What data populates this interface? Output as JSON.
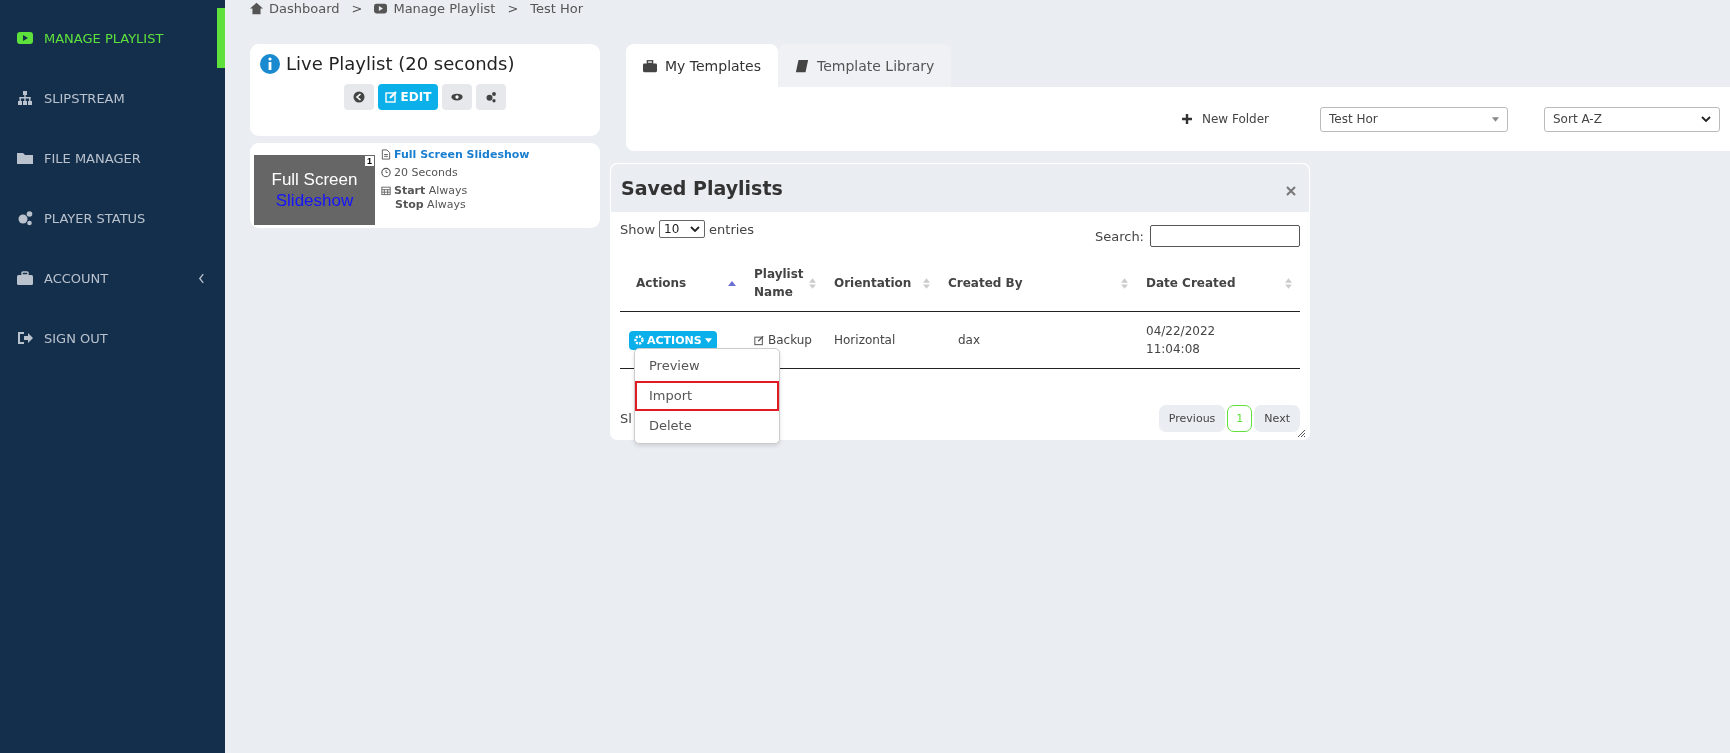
{
  "sidebar": {
    "items": [
      {
        "label": "MANAGE PLAYLIST",
        "selected": true,
        "has_submenu": false
      },
      {
        "label": "SLIPSTREAM",
        "selected": false,
        "has_submenu": false
      },
      {
        "label": "FILE MANAGER",
        "selected": false,
        "has_submenu": false
      },
      {
        "label": "PLAYER STATUS",
        "selected": false,
        "has_submenu": false
      },
      {
        "label": "ACCOUNT",
        "selected": false,
        "has_submenu": true
      },
      {
        "label": "SIGN OUT",
        "selected": false,
        "has_submenu": false
      }
    ]
  },
  "breadcrumb": [
    {
      "label": "Dashboard",
      "separator": ">"
    },
    {
      "label": "Manage Playlist",
      "separator": ">"
    },
    {
      "label": "Test Hor"
    }
  ],
  "live_playlist": {
    "title": "Live Playlist (20 seconds)",
    "edit_label": "EDIT",
    "items": [
      {
        "thumb_line_1": "Full Screen",
        "thumb_line_2": "Slideshow",
        "badge": "1",
        "name": "Full Screen Slideshow",
        "duration": "20 Seconds",
        "start_label": "Start",
        "start_value": "Always",
        "stop_label": "Stop",
        "stop_value": "Always"
      }
    ]
  },
  "tabs": [
    {
      "label": "My Templates",
      "selected": true
    },
    {
      "label": "Template Library",
      "selected": false
    }
  ],
  "toolbar": {
    "new_folder": "New Folder",
    "folder_select": "Test Hor",
    "sort_select": "Sort A-Z"
  },
  "dialog": {
    "title": "Saved Playlists",
    "show_label": "Show",
    "page_size": "10",
    "entries_label": "entries",
    "search_label": "Search:",
    "info_text": "Sl",
    "columns": [
      {
        "label": "Actions",
        "sorted": true
      },
      {
        "label": "Playlist Name",
        "sorted": false
      },
      {
        "label": "Orientation",
        "sorted": false
      },
      {
        "label": "Created By",
        "sorted": false
      },
      {
        "label": "Date Created",
        "sorted": false
      }
    ],
    "rows": [
      {
        "actions": "ACTIONS",
        "name": "Backup",
        "orientation": "Horizontal",
        "created_by": "dax",
        "date": "04/22/2022",
        "time": "11:04:08"
      }
    ],
    "menu": [
      {
        "label": "Preview",
        "highlighted": false
      },
      {
        "label": "Import",
        "highlighted": true
      },
      {
        "label": "Delete",
        "highlighted": false
      }
    ],
    "pagination": [
      {
        "label": "Previous",
        "kind": "nav",
        "selected": false
      },
      {
        "label": "1",
        "kind": "page",
        "selected": true
      },
      {
        "label": "Next",
        "kind": "nav",
        "selected": false
      }
    ]
  }
}
